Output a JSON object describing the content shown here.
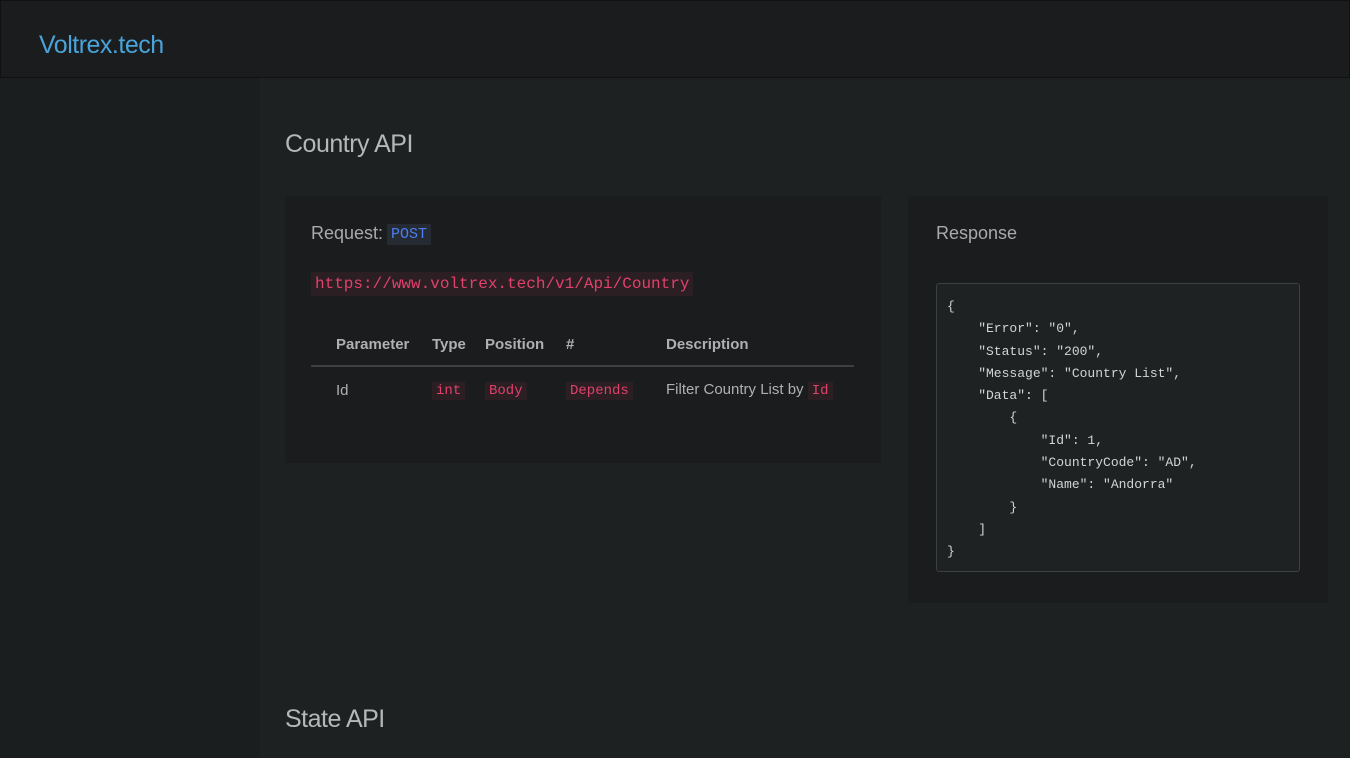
{
  "header": {
    "brand": "Voltrex.tech"
  },
  "sections": [
    {
      "title": "Country API",
      "request": {
        "label": "Request:",
        "method": "POST",
        "url": "https://www.voltrex.tech/v1/Api/Country"
      },
      "params_table": {
        "columns": [
          "Parameter",
          "Type",
          "Position",
          "#",
          "Description"
        ],
        "rows": [
          {
            "parameter": "Id",
            "type": "int",
            "position": "Body",
            "required": "Depends",
            "description": "Filter Country List by",
            "description_code": "Id"
          }
        ]
      },
      "response": {
        "label": "Response",
        "body": "{\n    \"Error\": \"0\",\n    \"Status\": \"200\",\n    \"Message\": \"Country List\",\n    \"Data\": [\n        {\n            \"Id\": 1,\n            \"CountryCode\": \"AD\",\n            \"Name\": \"Andorra\"\n        }\n    ]\n}"
      }
    },
    {
      "title": "State API"
    }
  ]
}
